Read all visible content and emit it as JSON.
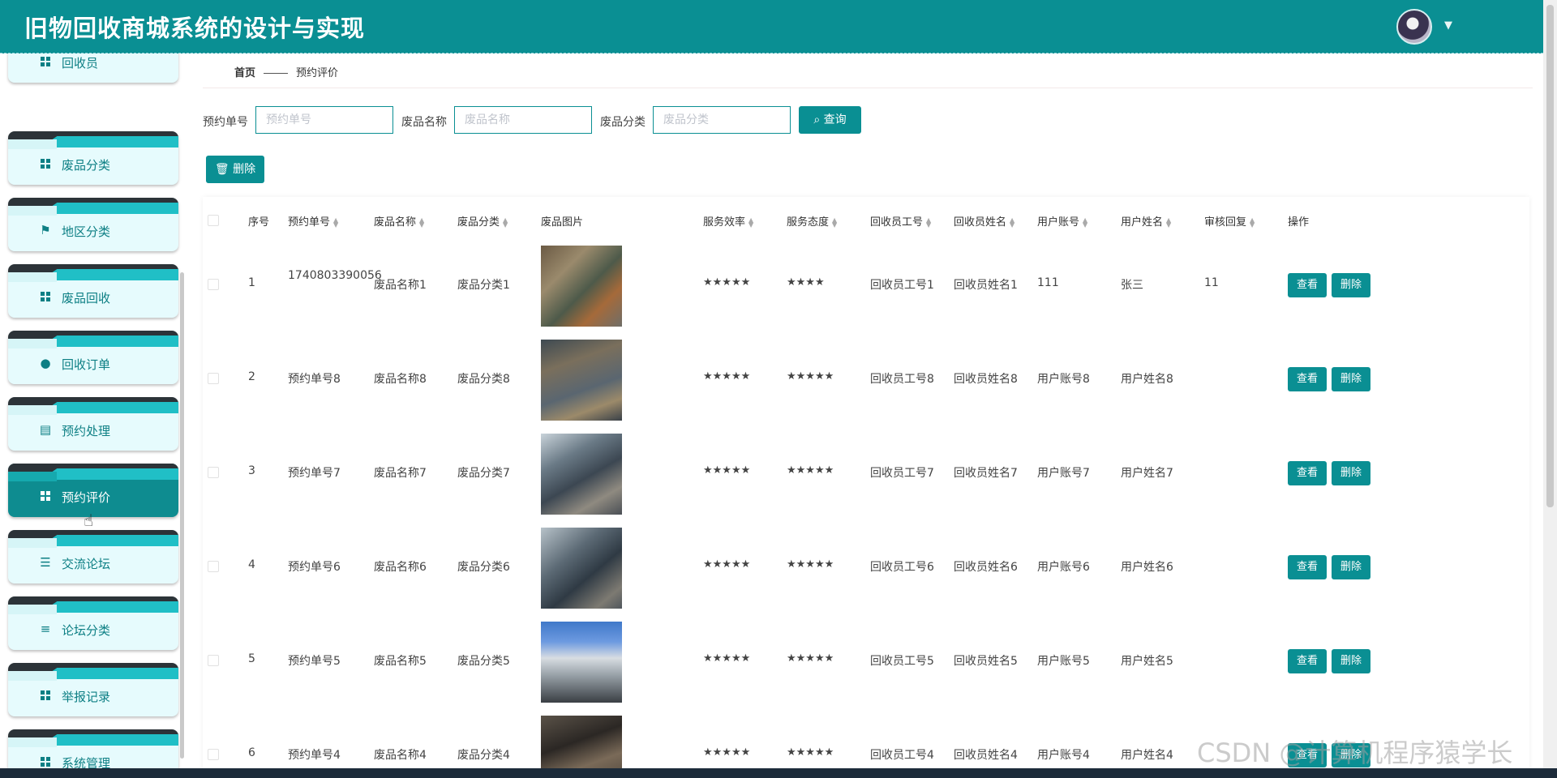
{
  "header": {
    "title": "旧物回收商城系统的设计与实现"
  },
  "sidebar": {
    "items": [
      {
        "label": "回收员",
        "icon": "grid-icon"
      },
      {
        "label": "废品分类",
        "icon": "grid-icon"
      },
      {
        "label": "地区分类",
        "icon": "flag-icon"
      },
      {
        "label": "废品回收",
        "icon": "grid-icon"
      },
      {
        "label": "回收订单",
        "icon": "user-icon"
      },
      {
        "label": "预约处理",
        "icon": "clipboard-icon"
      },
      {
        "label": "预约评价",
        "icon": "grid-icon",
        "active": true
      },
      {
        "label": "交流论坛",
        "icon": "sliders-icon"
      },
      {
        "label": "论坛分类",
        "icon": "list-icon"
      },
      {
        "label": "举报记录",
        "icon": "grid-icon"
      },
      {
        "label": "系统管理",
        "icon": "grid-icon"
      }
    ]
  },
  "breadcrumb": {
    "home": "首页",
    "current": "预约评价"
  },
  "search": {
    "order_label": "预约单号",
    "order_placeholder": "预约单号",
    "name_label": "废品名称",
    "name_placeholder": "废品名称",
    "category_label": "废品分类",
    "category_placeholder": "废品分类",
    "query_label": "查询"
  },
  "toolbar": {
    "delete_label": "删除"
  },
  "table": {
    "headers": {
      "index": "序号",
      "order_no": "预约单号",
      "item_name": "废品名称",
      "item_category": "废品分类",
      "item_image": "废品图片",
      "efficiency": "服务效率",
      "attitude": "服务态度",
      "collector_no": "回收员工号",
      "collector_name": "回收员姓名",
      "user_account": "用户账号",
      "user_name": "用户姓名",
      "reply": "审核回复",
      "actions": "操作"
    },
    "rows": [
      {
        "index": "1",
        "order_no": "1740803390056",
        "item_name": "废品名称1",
        "item_category": "废品分类1",
        "efficiency": "★★★★★",
        "attitude": "★★★★",
        "collector_no": "回收员工号1",
        "collector_name": "回收员姓名1",
        "user_account": "111",
        "user_name": "张三",
        "reply": "11"
      },
      {
        "index": "2",
        "order_no": "预约单号8",
        "item_name": "废品名称8",
        "item_category": "废品分类8",
        "efficiency": "★★★★★",
        "attitude": "★★★★★",
        "collector_no": "回收员工号8",
        "collector_name": "回收员姓名8",
        "user_account": "用户账号8",
        "user_name": "用户姓名8",
        "reply": ""
      },
      {
        "index": "3",
        "order_no": "预约单号7",
        "item_name": "废品名称7",
        "item_category": "废品分类7",
        "efficiency": "★★★★★",
        "attitude": "★★★★★",
        "collector_no": "回收员工号7",
        "collector_name": "回收员姓名7",
        "user_account": "用户账号7",
        "user_name": "用户姓名7",
        "reply": ""
      },
      {
        "index": "4",
        "order_no": "预约单号6",
        "item_name": "废品名称6",
        "item_category": "废品分类6",
        "efficiency": "★★★★★",
        "attitude": "★★★★★",
        "collector_no": "回收员工号6",
        "collector_name": "回收员姓名6",
        "user_account": "用户账号6",
        "user_name": "用户姓名6",
        "reply": ""
      },
      {
        "index": "5",
        "order_no": "预约单号5",
        "item_name": "废品名称5",
        "item_category": "废品分类5",
        "efficiency": "★★★★★",
        "attitude": "★★★★★",
        "collector_no": "回收员工号5",
        "collector_name": "回收员姓名5",
        "user_account": "用户账号5",
        "user_name": "用户姓名5",
        "reply": ""
      },
      {
        "index": "6",
        "order_no": "预约单号4",
        "item_name": "废品名称4",
        "item_category": "废品分类4",
        "efficiency": "★★★★★",
        "attitude": "★★★★★",
        "collector_no": "回收员工号4",
        "collector_name": "回收员姓名4",
        "user_account": "用户账号4",
        "user_name": "用户姓名4",
        "reply": ""
      }
    ],
    "view_label": "查看",
    "delete_label": "删除"
  },
  "watermark": "CSDN @计算机程序猿学长",
  "colors": {
    "primary": "#0a8f93",
    "sidebar_bg": "#e6fbfd",
    "active_bg": "#0e8c90"
  }
}
